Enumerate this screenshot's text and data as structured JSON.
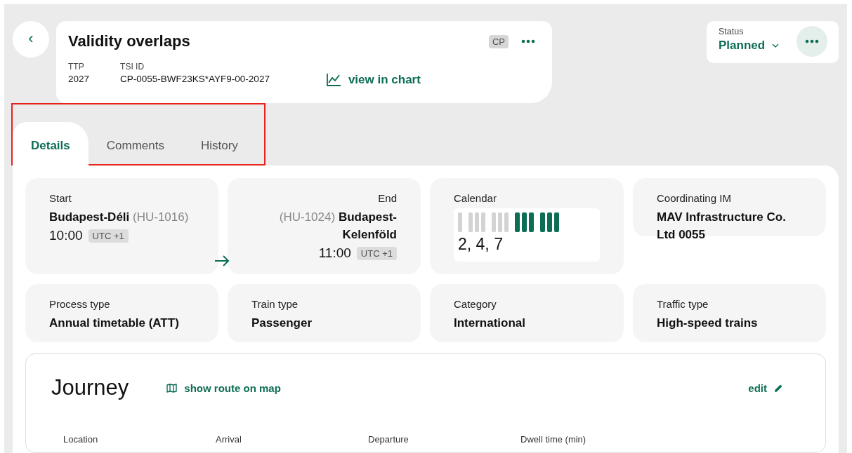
{
  "header": {
    "back_label": "‹",
    "title": "Validity overlaps",
    "badge": "CP",
    "fields": [
      {
        "label": "TTP",
        "value": "2027"
      },
      {
        "label": "TSI ID",
        "value": "CP-0055-BWF23KS*AYF9-00-2027"
      }
    ],
    "chart_link": "view in chart"
  },
  "status": {
    "label": "Status",
    "value": "Planned"
  },
  "tabs": [
    {
      "label": "Details",
      "selected": true
    },
    {
      "label": "Comments",
      "selected": false
    },
    {
      "label": "History",
      "selected": false
    }
  ],
  "tabs_highlighted": true,
  "start": {
    "label": "Start",
    "name": "Budapest-Déli",
    "code": "(HU-1016)",
    "time": "10:00",
    "zone": "UTC +1"
  },
  "end": {
    "label": "End",
    "name": "Budapest-Kelenföld",
    "code": "(HU-1024)",
    "time": "11:00",
    "zone": "UTC +1"
  },
  "calendar": {
    "label": "Calendar",
    "groups": [
      [
        {
          "on": false
        }
      ],
      [
        {
          "on": false
        },
        {
          "on": false
        },
        {
          "on": false
        }
      ],
      [
        {
          "on": false
        },
        {
          "on": false
        },
        {
          "on": false
        }
      ],
      [
        {
          "on": true
        },
        {
          "on": true
        },
        {
          "on": true
        }
      ],
      [
        {
          "on": true
        },
        {
          "on": true
        },
        {
          "on": true
        }
      ]
    ],
    "days": "2, 4, 7"
  },
  "info": [
    {
      "label": "Coordinating IM",
      "value": "MAV Infrastructure Co. Ltd 0055"
    },
    {
      "label": "Process type",
      "value": "Annual timetable (ATT)"
    },
    {
      "label": "Train type",
      "value": "Passenger"
    },
    {
      "label": "Category",
      "value": "International"
    },
    {
      "label": "Traffic type",
      "value": "High-speed trains"
    }
  ],
  "journey": {
    "title": "Journey",
    "map_link": "show route on map",
    "edit_link": "edit",
    "columns": [
      "Location",
      "Arrival",
      "Departure",
      "Dwell time (min)"
    ]
  }
}
